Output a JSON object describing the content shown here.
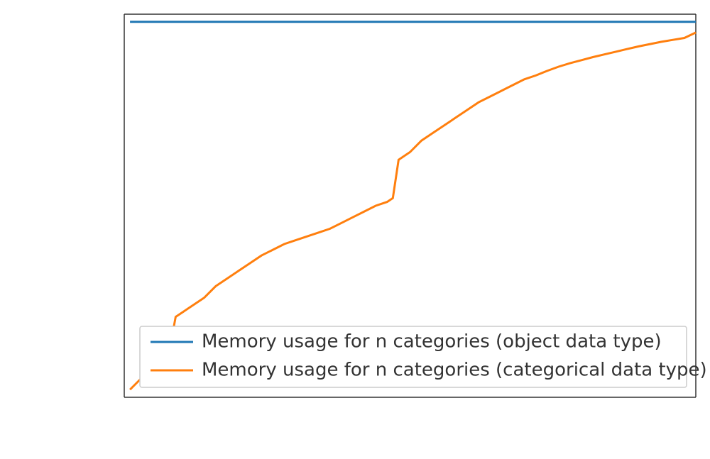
{
  "chart_data": {
    "type": "line",
    "title": "",
    "xlabel": "",
    "ylabel": "",
    "xlim": [
      0,
      100
    ],
    "ylim": [
      0,
      100
    ],
    "series": [
      {
        "name": "Memory usage for n categories (object data type)",
        "color": "#1f77b4",
        "x": [
          1,
          100
        ],
        "values": [
          98,
          98
        ]
      },
      {
        "name": "Memory usage for n categories (categorical data type)",
        "color": "#ff7f0e",
        "x": [
          1,
          3,
          5,
          7,
          8,
          9,
          10,
          11,
          12,
          14,
          16,
          18,
          20,
          22,
          24,
          26,
          28,
          30,
          32,
          34,
          36,
          38,
          40,
          42,
          44,
          46,
          47,
          48,
          49,
          50,
          52,
          54,
          56,
          58,
          60,
          62,
          64,
          66,
          68,
          70,
          72,
          74,
          76,
          78,
          80,
          82,
          84,
          86,
          88,
          90,
          92,
          94,
          96,
          98,
          100
        ],
        "values": [
          2,
          5,
          8,
          11,
          13,
          21,
          22,
          23,
          24,
          26,
          29,
          31,
          33,
          35,
          37,
          38.5,
          40,
          41,
          42,
          43,
          44,
          45.5,
          47,
          48.5,
          50,
          51,
          52,
          62,
          63,
          64,
          67,
          69,
          71,
          73,
          75,
          77,
          78.5,
          80,
          81.5,
          83,
          84,
          85.2,
          86.3,
          87.2,
          88,
          88.8,
          89.5,
          90.2,
          90.9,
          91.6,
          92.2,
          92.8,
          93.3,
          93.8,
          95.2
        ]
      }
    ],
    "legend": {
      "position": "lower-center",
      "labels": [
        "Memory usage for n categories (object data type)",
        "Memory usage for n categories (categorical data type)"
      ]
    }
  }
}
